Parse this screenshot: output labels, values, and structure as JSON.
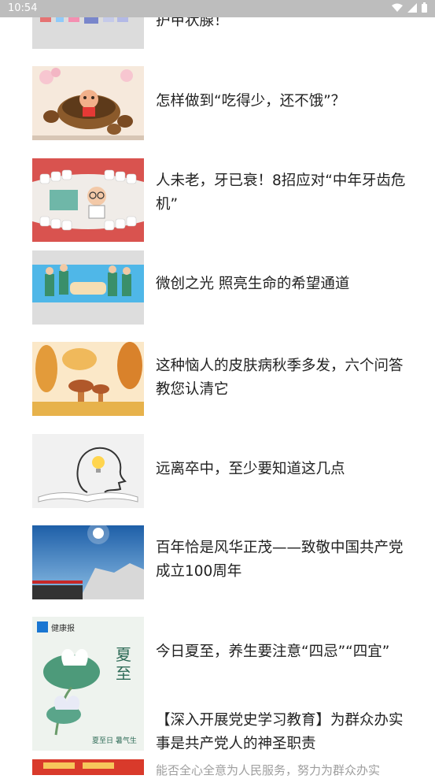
{
  "status_bar": {
    "time": "10:54"
  },
  "articles": [
    {
      "title": "护甲状腺！"
    },
    {
      "title": "怎样做到“吃得少，还不饿”？"
    },
    {
      "title": "人未老，牙已衰！8招应对“中年牙齿危机”"
    },
    {
      "title": "微创之光 照亮生命的希望通道"
    },
    {
      "title": "这种恼人的皮肤病秋季多发，六个问答教您认清它"
    },
    {
      "title": "远离卒中，至少要知道这几点"
    },
    {
      "title": "百年恰是风华正茂——致敬中国共产党成立100周年"
    },
    {
      "title": "今日夏至，养生要注意“四忌”“四宜”",
      "thumb_text": {
        "logo": "健康报",
        "big": "夏至",
        "small": "夏至日 暑气生"
      }
    },
    {
      "title": "【深入开展党史学习教育】为群众办实事是共产党人的神圣职责",
      "subtitle": "能否全心全意为人民服务，努力为群众办实"
    }
  ]
}
